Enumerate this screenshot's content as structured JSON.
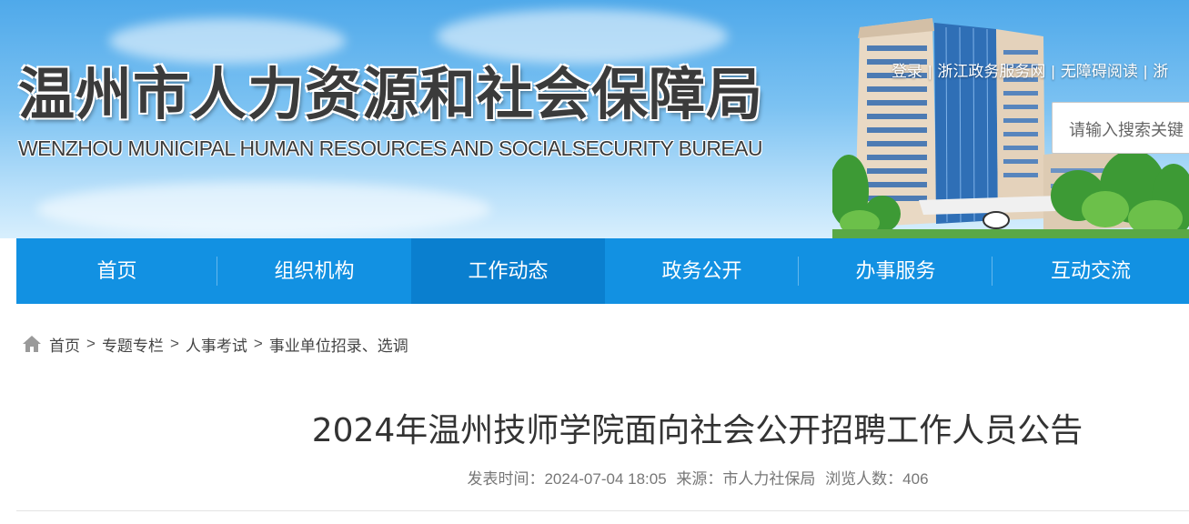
{
  "header": {
    "title_cn": "温州市人力资源和社会保障局",
    "title_en": "WENZHOU MUNICIPAL HUMAN RESOURCES AND SOCIALSECURITY BUREAU",
    "top_links": [
      "登录",
      "浙江政务服务网",
      "无障碍阅读",
      "浙"
    ],
    "search_placeholder": "请输入搜索关键"
  },
  "nav": {
    "items": [
      {
        "label": "首页"
      },
      {
        "label": "组织机构"
      },
      {
        "label": "工作动态",
        "active": true
      },
      {
        "label": "政务公开"
      },
      {
        "label": "办事服务"
      },
      {
        "label": "互动交流"
      }
    ]
  },
  "breadcrumb": {
    "icon": "home-icon",
    "items": [
      "首页",
      "专题专栏",
      "人事考试",
      "事业单位招录、选调"
    ],
    "separator": ">"
  },
  "article": {
    "title": "2024年温州技师学院面向社会公开招聘工作人员公告",
    "publish_label": "发表时间：",
    "publish_time": "2024-07-04 18:05",
    "source_label": "来源：",
    "source": "市人力社保局",
    "views_label": "浏览人数：",
    "views": "406"
  },
  "colors": {
    "nav_bg": "#1291e2",
    "nav_active_bg": "#0a7fcf",
    "banner_sky": "#6bb9f0",
    "title_text": "#3b3b3b"
  }
}
